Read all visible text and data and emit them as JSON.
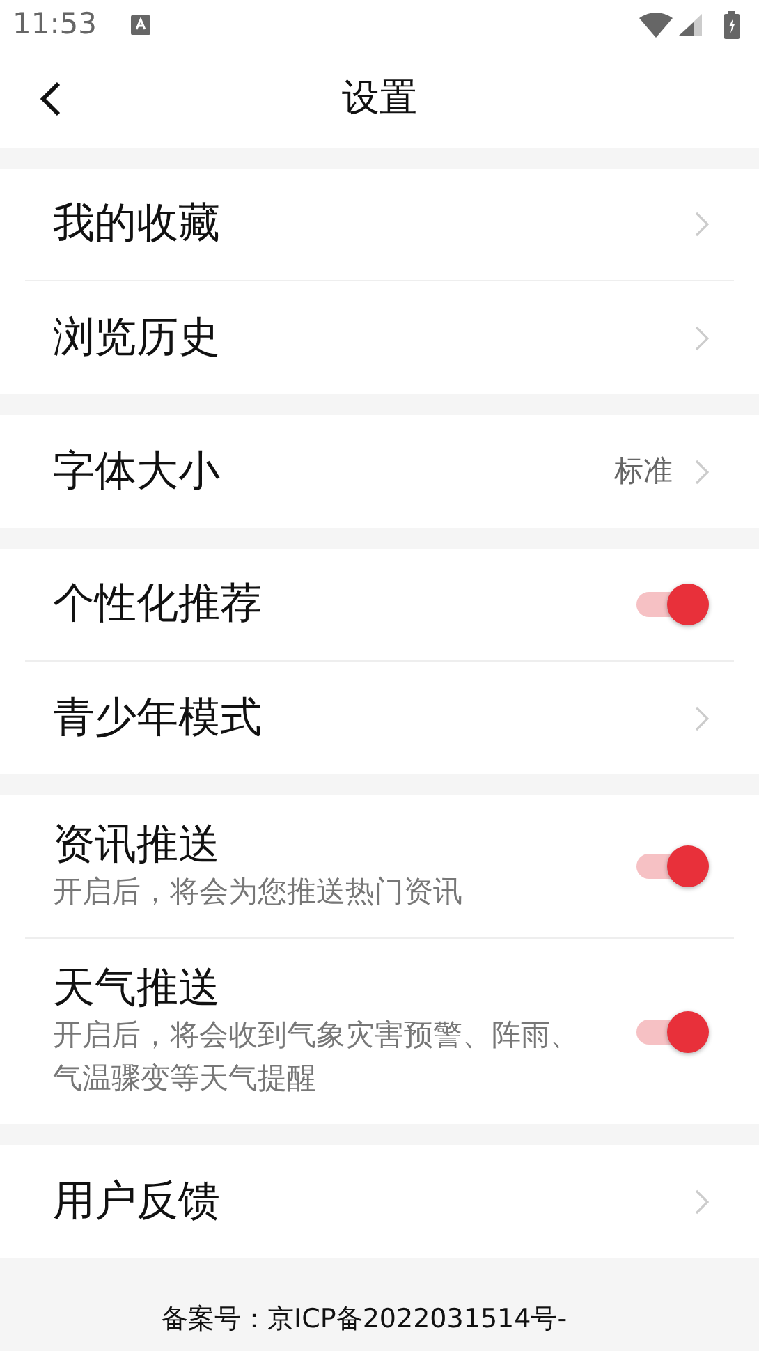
{
  "status_bar": {
    "time": "11:53"
  },
  "header": {
    "title": "设置"
  },
  "groups": [
    {
      "rows": [
        {
          "kind": "link",
          "title": "我的收藏"
        },
        {
          "kind": "link",
          "title": "浏览历史"
        }
      ]
    },
    {
      "rows": [
        {
          "kind": "link",
          "title": "字体大小",
          "value": "标准"
        }
      ]
    },
    {
      "rows": [
        {
          "kind": "toggle",
          "title": "个性化推荐",
          "on": true
        },
        {
          "kind": "link",
          "title": "青少年模式"
        }
      ]
    },
    {
      "rows": [
        {
          "kind": "toggle",
          "title": "资讯推送",
          "subtitle": "开启后，将会为您推送热门资讯",
          "on": true
        },
        {
          "kind": "toggle",
          "title": "天气推送",
          "subtitle": "开启后，将会收到气象灾害预警、阵雨、气温骤变等天气提醒",
          "on": true
        }
      ]
    },
    {
      "rows": [
        {
          "kind": "link",
          "title": "用户反馈"
        }
      ]
    }
  ],
  "footer": {
    "text": "备案号：京ICP备2022031514号-"
  }
}
